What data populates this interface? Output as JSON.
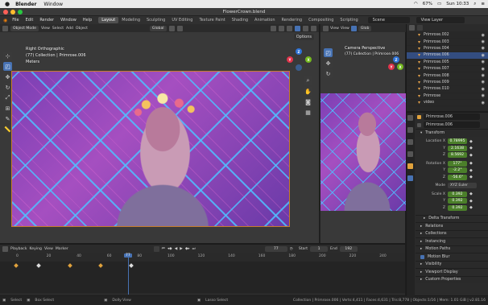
{
  "mac": {
    "app": "Blender",
    "menu": [
      "Window"
    ],
    "battery": "67%",
    "day_time": "Sun 10:33"
  },
  "title": "FlowerCrown.blend",
  "menubar": {
    "items": [
      "File",
      "Edit",
      "Render",
      "Window",
      "Help"
    ],
    "workspaces": [
      "Layout",
      "Modeling",
      "Sculpting",
      "UV Editing",
      "Texture Paint",
      "Shading",
      "Animation",
      "Rendering",
      "Compositing",
      "Scripting"
    ],
    "active_workspace": "Layout",
    "scene_label": "Scene",
    "viewlayer_label": "View Layer"
  },
  "viewport": {
    "mode": "Object Mode",
    "menus": [
      "View",
      "Select",
      "Add",
      "Object"
    ],
    "orientation": "Global",
    "options": "Options",
    "overlay": [
      "Right Orthographic",
      "(77) Collection | Primrose.006",
      "Meters"
    ]
  },
  "camera_view": {
    "header_menus": [
      "View",
      "View",
      "Glob"
    ],
    "overlay": [
      "Camera Perspective",
      "(77) Collection | Primrose.006"
    ]
  },
  "outliner": {
    "items": [
      {
        "name": "Primrose.002",
        "selected": false
      },
      {
        "name": "Primrose.003",
        "selected": false
      },
      {
        "name": "Primrose.004",
        "selected": false
      },
      {
        "name": "Primrose.006",
        "selected": true
      },
      {
        "name": "Primrose.005",
        "selected": false
      },
      {
        "name": "Primrose.007",
        "selected": false
      },
      {
        "name": "Primrose.008",
        "selected": false
      },
      {
        "name": "Primrose.009",
        "selected": false
      },
      {
        "name": "Primrose.010",
        "selected": false
      },
      {
        "name": "Primrose",
        "selected": false
      },
      {
        "name": "video",
        "selected": false
      }
    ]
  },
  "properties": {
    "object_name": "Primrose.006",
    "data_name": "Primrose.006",
    "transform_label": "Transform",
    "location_label": "Location X",
    "location": [
      "0.78995",
      "2.1638",
      "8.5692"
    ],
    "rotation_label": "Rotation X",
    "rotation": [
      "177°",
      "-2.2°",
      "-56.6°"
    ],
    "mode_label": "Mode",
    "mode": "XYZ Euler",
    "scale_label": "Scale X",
    "scale": [
      "0.392",
      "0.392",
      "0.392"
    ],
    "axis_y": "Y",
    "axis_z": "Z",
    "delta": "Delta Transform",
    "sections": [
      "Relations",
      "Collections",
      "Instancing",
      "Motion Paths"
    ],
    "motion_blur": "Motion Blur",
    "sections2": [
      "Visibility",
      "Viewport Display",
      "Custom Properties"
    ]
  },
  "timeline": {
    "menus": [
      "Playback",
      "Keying",
      "View",
      "Marker"
    ],
    "current_frame": "77",
    "start_label": "Start",
    "start": "1",
    "end_label": "End",
    "end": "192",
    "ticks": [
      "0",
      "20",
      "40",
      "60",
      "80",
      "100",
      "120",
      "140",
      "160",
      "180",
      "200",
      "220",
      "240"
    ],
    "frame_marker": "77"
  },
  "status": {
    "select": "Select",
    "box_select": "Box Select",
    "dolly": "Dolly View",
    "lasso": "Lasso Select",
    "info": "Collection | Primrose.006 | Verts:4,411 | Faces:4,631 | Tris:8,778 | Objects:1/16 | Mem: 1.01 GiB | v2.81.16"
  },
  "colors": {
    "accent": "#4772b3",
    "field_green": "#4b7f2a",
    "keyframe": "#e0a23c",
    "frame_blue": "#4772b3"
  },
  "icons": [
    "apple-icon",
    "blender-logo-icon",
    "wifi-icon",
    "battery-icon",
    "search-icon",
    "menu-icon",
    "cursor-icon",
    "move-icon",
    "rotate-icon",
    "scale-icon",
    "transform-icon",
    "annotate-icon",
    "measure-icon",
    "camera-icon",
    "hand-icon",
    "zoom-icon",
    "eye-icon",
    "filter-icon",
    "play-icon",
    "keyframe-icon",
    "object-icon",
    "wrench-icon"
  ]
}
